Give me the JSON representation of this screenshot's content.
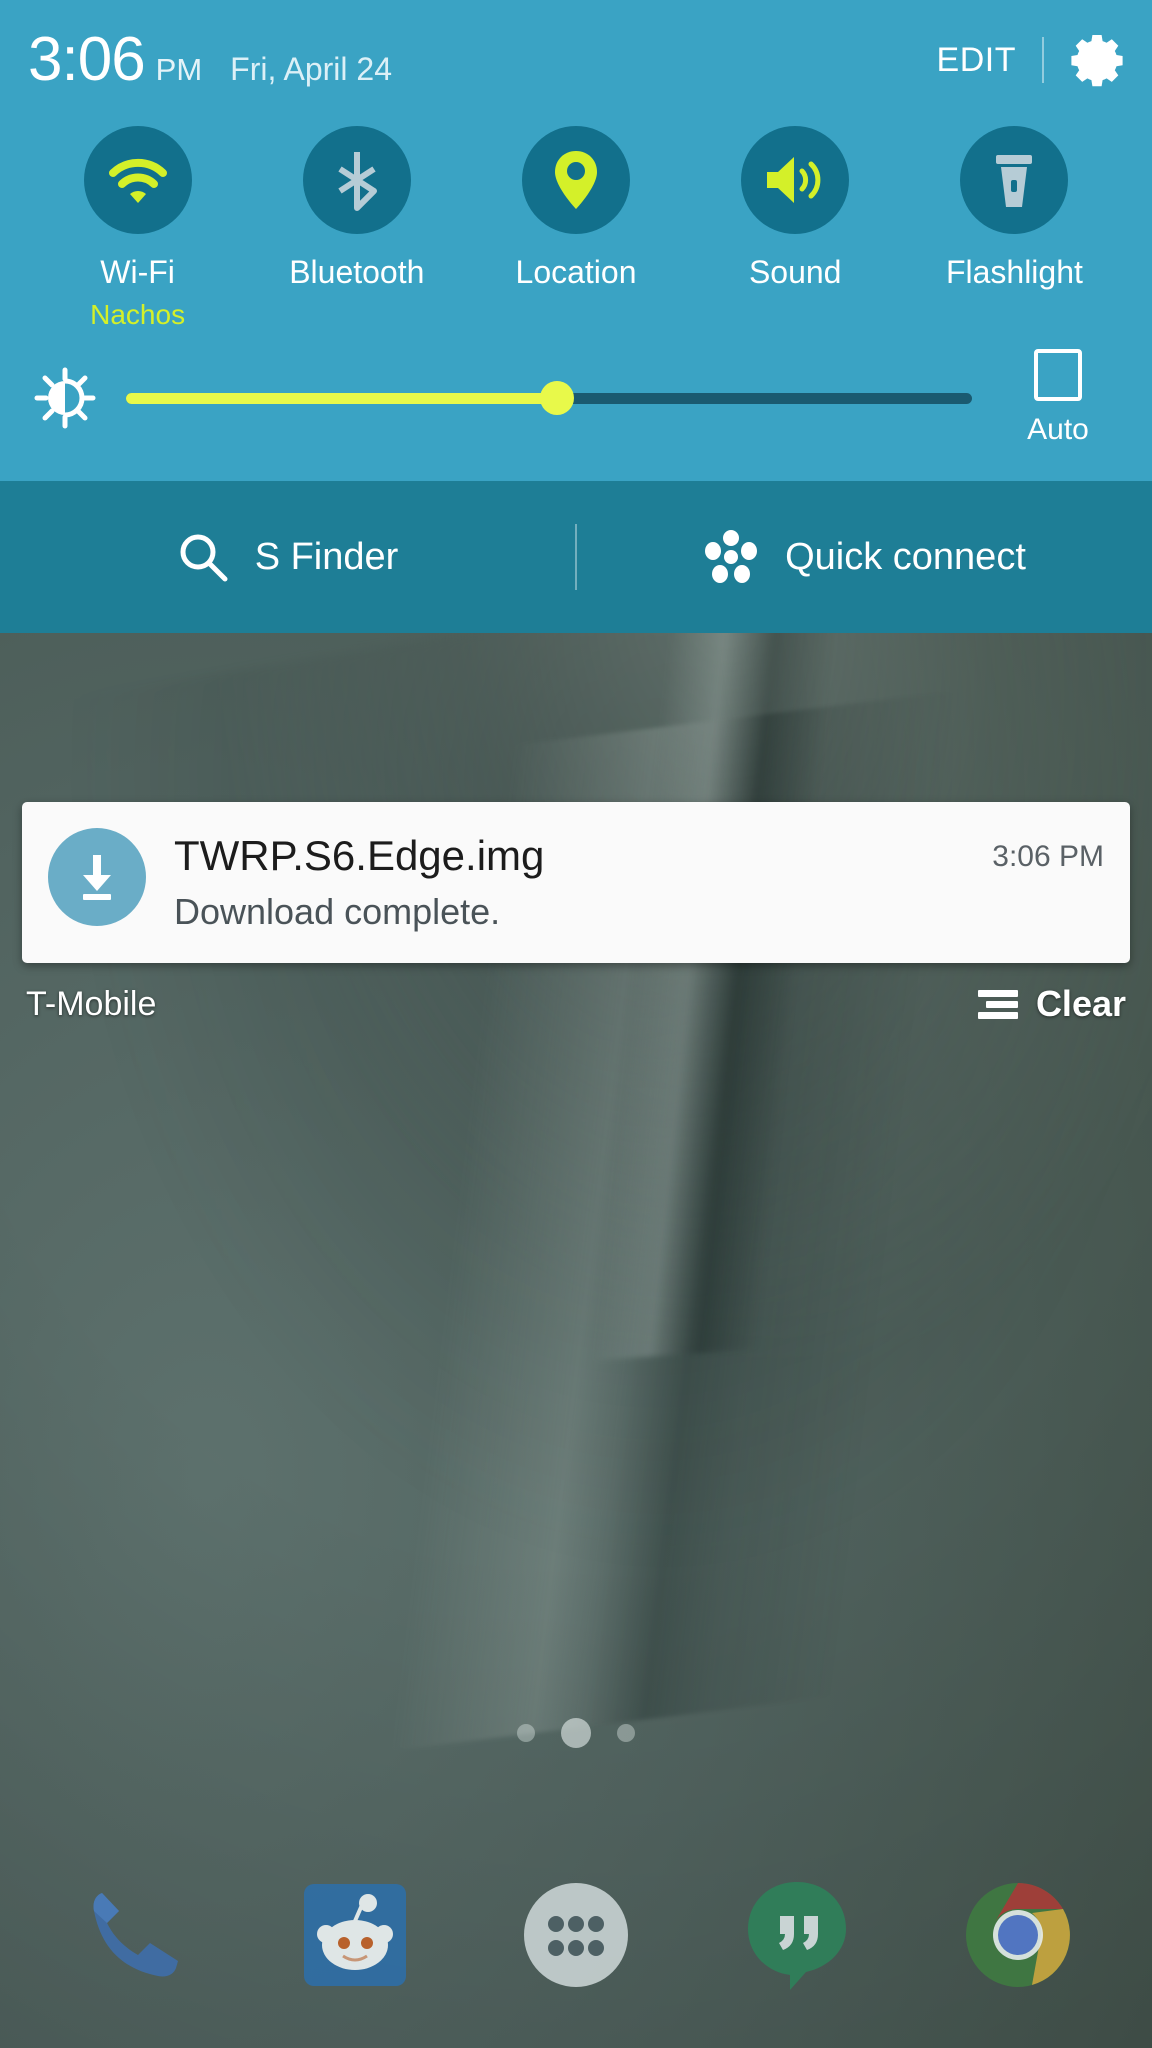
{
  "status": {
    "time": "3:06",
    "ampm": "PM",
    "date": "Fri, April 24",
    "edit_label": "EDIT",
    "settings_icon": "gear-icon"
  },
  "quick_toggles": [
    {
      "label": "Wi-Fi",
      "sublabel": "Nachos",
      "icon": "wifi-icon",
      "active": true
    },
    {
      "label": "Bluetooth",
      "sublabel": "",
      "icon": "bluetooth-icon",
      "active": false
    },
    {
      "label": "Location",
      "sublabel": "",
      "icon": "location-pin-icon",
      "active": true
    },
    {
      "label": "Sound",
      "sublabel": "",
      "icon": "volume-icon",
      "active": true
    },
    {
      "label": "Flashlight",
      "sublabel": "",
      "icon": "flashlight-icon",
      "active": false
    }
  ],
  "brightness": {
    "icon": "brightness-icon",
    "value_percent": 51,
    "auto_label": "Auto",
    "auto_checked": false
  },
  "search_bar": {
    "s_finder_label": "S Finder",
    "s_finder_icon": "search-icon",
    "quick_connect_label": "Quick connect",
    "quick_connect_icon": "quick-connect-icon"
  },
  "notifications": [
    {
      "title": "TWRP.S6.Edge.img",
      "text": "Download complete.",
      "time": "3:06 PM",
      "icon": "download-icon"
    }
  ],
  "footer": {
    "carrier": "T-Mobile",
    "clear_label": "Clear",
    "clear_icon": "clear-lines-icon"
  },
  "home": {
    "page_dots": 3,
    "active_page": 2,
    "dock": [
      {
        "name": "phone-icon"
      },
      {
        "name": "reddit-icon"
      },
      {
        "name": "app-drawer-icon"
      },
      {
        "name": "hangouts-icon"
      },
      {
        "name": "chrome-icon"
      }
    ]
  },
  "colors": {
    "panel_top": "#3aa3c4",
    "panel_search": "#1e7e96",
    "toggle_circle": "#12708c",
    "accent_lime": "#d4f029",
    "inactive_gray": "#b6ccd6",
    "card_bg": "#fafafa"
  }
}
